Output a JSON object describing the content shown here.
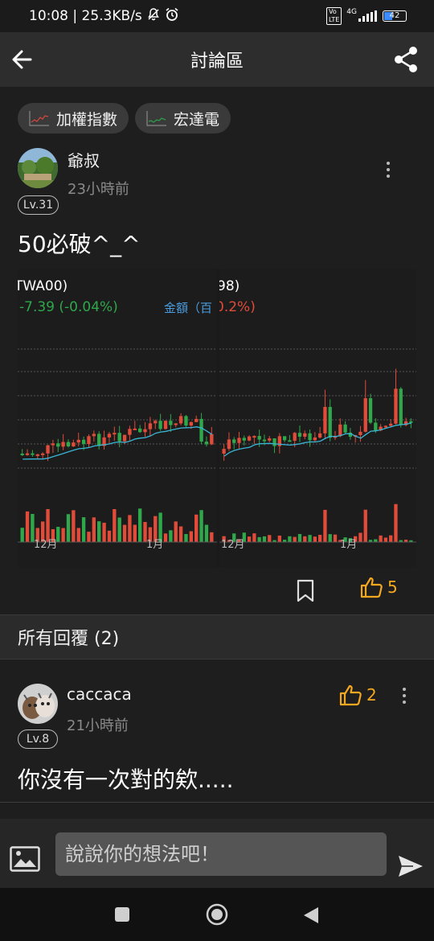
{
  "status_bar": {
    "time": "10:08 | 25.3KB/s",
    "network": "4G",
    "battery": "42"
  },
  "app_bar": {
    "title": "討論區",
    "back_icon": "arrow-left-icon",
    "share_icon": "share-icon"
  },
  "tags": [
    {
      "label": "加權指數",
      "icon": "mini-line-chart-icon",
      "line_color": "#d0463c"
    },
    {
      "label": "宏達電",
      "icon": "mini-line-chart-icon",
      "line_color": "#2f9a4a"
    }
  ],
  "post": {
    "author": "爺叔",
    "time": "23小時前",
    "level": "Lv.31",
    "text": "50必破^_^",
    "like_count": "5",
    "charts": [
      {
        "title": "TWA00)",
        "change": "-7.39 (-0.04%)",
        "change_color": "#2ea84b",
        "extra": "金額（百",
        "months": [
          "12月",
          "1月"
        ]
      },
      {
        "title": "98)",
        "change": "0.2%)",
        "change_color": "#e04b3a",
        "extra": "",
        "months": [
          "12月",
          "1月"
        ]
      }
    ]
  },
  "replies": {
    "header": "所有回覆 (2)",
    "items": [
      {
        "author": "caccaca",
        "time": "21小時前",
        "level": "Lv.8",
        "text": "你沒有一次對的欸.....",
        "like_count": "2"
      }
    ]
  },
  "composer": {
    "placeholder": "說說你的想法吧！"
  },
  "colors": {
    "accent_like": "#f3a81f",
    "candle_up": "#e04b3a",
    "candle_down": "#2ea84b",
    "ma_line": "#39b6d6",
    "background": "#1e1e1e"
  }
}
